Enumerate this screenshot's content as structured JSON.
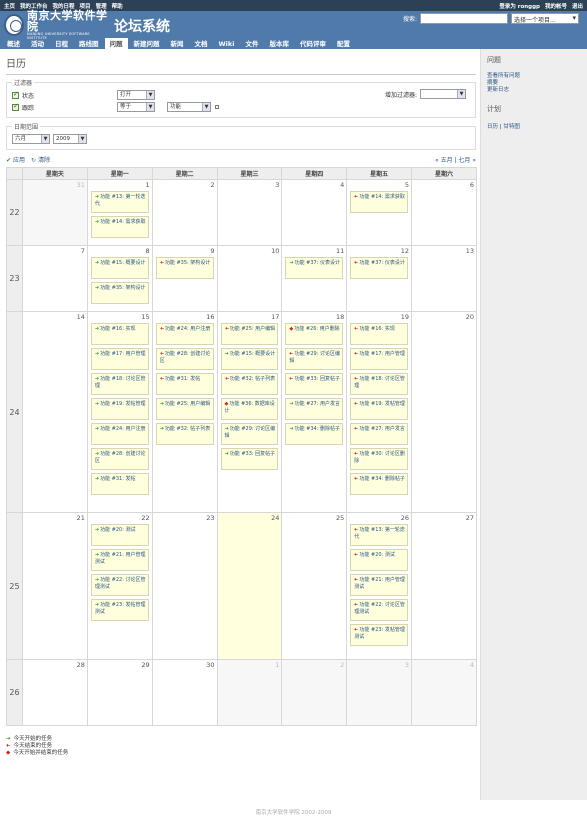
{
  "top_menu": {
    "left": [
      "主页",
      "我的工作台",
      "我的日程",
      "项目",
      "管理",
      "帮助"
    ],
    "right": [
      "登录为 ronggp",
      "我的帐号",
      "退出"
    ]
  },
  "header": {
    "logo_main": "南京大学软件学院",
    "logo_sub": "NANJING UNIVERSITY   SOFTWARE INSTITUTE",
    "project_title": "论坛系统",
    "search_label": "搜索:",
    "search_value": "",
    "project_jump": "选择一个项目..."
  },
  "main_menu": [
    {
      "label": "概述",
      "selected": false
    },
    {
      "label": "活动",
      "selected": false
    },
    {
      "label": "日程",
      "selected": false
    },
    {
      "label": "路线图",
      "selected": false
    },
    {
      "label": "问题",
      "selected": true
    },
    {
      "label": "新建问题",
      "selected": false
    },
    {
      "label": "新闻",
      "selected": false
    },
    {
      "label": "文档",
      "selected": false
    },
    {
      "label": "Wiki",
      "selected": false
    },
    {
      "label": "文件",
      "selected": false
    },
    {
      "label": "版本库",
      "selected": false
    },
    {
      "label": "代码评审",
      "selected": false
    },
    {
      "label": "配置",
      "selected": false
    }
  ],
  "page": {
    "title": "日历",
    "filters_legend": "过滤器",
    "filter_status": {
      "label": "状态",
      "operator": "打开"
    },
    "filter_tracker": {
      "label": "跟踪",
      "operator": "等于",
      "value": "功能"
    },
    "add_filter_label": "增加过滤器:",
    "date_range_legend": "日期范围",
    "month": "六月",
    "year": "2009",
    "apply": "应用",
    "clear": "清除",
    "month_nav": "« 五月 | 七月 »"
  },
  "calendar": {
    "weekdays": [
      "星期天",
      "星期一",
      "星期二",
      "星期三",
      "星期四",
      "星期五",
      "星期六"
    ],
    "weeks": [
      {
        "num": "22",
        "days": [
          {
            "d": "31",
            "odd": true,
            "issues": []
          },
          {
            "d": "1",
            "issues": [
              {
                "t": "start",
                "text": "功能 #13: 第一轮迭代"
              },
              {
                "t": "start",
                "text": "功能 #14: 需求获取"
              }
            ]
          },
          {
            "d": "2",
            "issues": []
          },
          {
            "d": "3",
            "issues": []
          },
          {
            "d": "4",
            "issues": []
          },
          {
            "d": "5",
            "issues": [
              {
                "t": "end",
                "text": "功能 #14: 需求获取"
              }
            ]
          },
          {
            "d": "6",
            "issues": []
          }
        ]
      },
      {
        "num": "23",
        "days": [
          {
            "d": "7",
            "issues": []
          },
          {
            "d": "8",
            "issues": [
              {
                "t": "start",
                "text": "功能 #15: 概要设计"
              },
              {
                "t": "start",
                "text": "功能 #35: 架构设计"
              }
            ]
          },
          {
            "d": "9",
            "issues": [
              {
                "t": "end",
                "text": "功能 #35: 架构设计"
              }
            ]
          },
          {
            "d": "10",
            "issues": []
          },
          {
            "d": "11",
            "issues": [
              {
                "t": "start",
                "text": "功能 #37: 仪表设计"
              }
            ]
          },
          {
            "d": "12",
            "issues": [
              {
                "t": "end",
                "text": "功能 #37: 仪表设计"
              }
            ]
          },
          {
            "d": "13",
            "issues": []
          }
        ]
      },
      {
        "num": "24",
        "days": [
          {
            "d": "14",
            "issues": []
          },
          {
            "d": "15",
            "issues": [
              {
                "t": "start",
                "text": "功能 #16: 实现"
              },
              {
                "t": "start",
                "text": "功能 #17: 用户管理"
              },
              {
                "t": "start",
                "text": "功能 #18: 讨论区管理"
              },
              {
                "t": "start",
                "text": "功能 #19: 发帖管理"
              },
              {
                "t": "start",
                "text": "功能 #24: 用户注册"
              },
              {
                "t": "start",
                "text": "功能 #28: 创建讨论区"
              },
              {
                "t": "start",
                "text": "功能 #31: 发帖"
              }
            ]
          },
          {
            "d": "16",
            "issues": [
              {
                "t": "end",
                "text": "功能 #24: 用户注册"
              },
              {
                "t": "end",
                "text": "功能 #28: 创建讨论区"
              },
              {
                "t": "end",
                "text": "功能 #31: 发帖"
              },
              {
                "t": "start",
                "text": "功能 #25: 用户编辑"
              },
              {
                "t": "start",
                "text": "功能 #32: 帖子列表"
              }
            ]
          },
          {
            "d": "17",
            "issues": [
              {
                "t": "end",
                "text": "功能 #25: 用户编辑"
              },
              {
                "t": "start",
                "text": "功能 #15: 概要设计"
              },
              {
                "t": "end",
                "text": "功能 #32: 帖子列表"
              },
              {
                "t": "both",
                "text": "功能 #36: 数据库设计"
              },
              {
                "t": "start",
                "text": "功能 #29: 讨论区编辑"
              },
              {
                "t": "start",
                "text": "功能 #33: 回复帖子"
              }
            ]
          },
          {
            "d": "18",
            "issues": [
              {
                "t": "both",
                "text": "功能 #26: 用户删除"
              },
              {
                "t": "end",
                "text": "功能 #29: 讨论区编辑"
              },
              {
                "t": "end",
                "text": "功能 #33: 回复帖子"
              },
              {
                "t": "start",
                "text": "功能 #27: 用户发言"
              },
              {
                "t": "start",
                "text": "功能 #34: 删除帖子"
              }
            ]
          },
          {
            "d": "19",
            "issues": [
              {
                "t": "end",
                "text": "功能 #16: 实现"
              },
              {
                "t": "end",
                "text": "功能 #17: 用户管理"
              },
              {
                "t": "end",
                "text": "功能 #18: 讨论区管理"
              },
              {
                "t": "end",
                "text": "功能 #19: 发帖管理"
              },
              {
                "t": "end",
                "text": "功能 #27: 用户发言"
              },
              {
                "t": "end",
                "text": "功能 #30: 讨论区删除"
              },
              {
                "t": "end",
                "text": "功能 #34: 删除帖子"
              }
            ]
          },
          {
            "d": "20",
            "issues": []
          }
        ]
      },
      {
        "num": "25",
        "days": [
          {
            "d": "21",
            "issues": []
          },
          {
            "d": "22",
            "issues": [
              {
                "t": "start",
                "text": "功能 #20: 测试"
              },
              {
                "t": "start",
                "text": "功能 #21: 用户管理测试"
              },
              {
                "t": "start",
                "text": "功能 #22: 讨论区管理测试"
              },
              {
                "t": "start",
                "text": "功能 #23: 发帖管理测试"
              }
            ]
          },
          {
            "d": "23",
            "issues": []
          },
          {
            "d": "24",
            "today": true,
            "issues": []
          },
          {
            "d": "25",
            "issues": []
          },
          {
            "d": "26",
            "issues": [
              {
                "t": "end",
                "text": "功能 #13: 第一轮迭代"
              },
              {
                "t": "end",
                "text": "功能 #20: 测试"
              },
              {
                "t": "end",
                "text": "功能 #21: 用户管理测试"
              },
              {
                "t": "end",
                "text": "功能 #22: 讨论区管理测试"
              },
              {
                "t": "end",
                "text": "功能 #23: 发帖管理测试"
              }
            ]
          },
          {
            "d": "27",
            "issues": []
          }
        ]
      },
      {
        "num": "26",
        "days": [
          {
            "d": "28",
            "issues": []
          },
          {
            "d": "29",
            "issues": []
          },
          {
            "d": "30",
            "issues": []
          },
          {
            "d": "1",
            "odd": true,
            "issues": []
          },
          {
            "d": "2",
            "odd": true,
            "issues": []
          },
          {
            "d": "3",
            "odd": true,
            "issues": []
          },
          {
            "d": "4",
            "odd": true,
            "issues": []
          }
        ]
      }
    ]
  },
  "legend": [
    {
      "t": "start",
      "text": "今天开始的任务"
    },
    {
      "t": "end",
      "text": "今天结束的任务"
    },
    {
      "t": "both",
      "text": "今天开始并结束的任务"
    }
  ],
  "sidebar": {
    "issues_title": "问题",
    "issues_links": [
      "查看所有问题",
      "摘要",
      "更新日志"
    ],
    "plan_title": "计划",
    "plan_links": [
      "日历",
      "甘特图"
    ]
  },
  "footer": "南京大学软件学院 2002-2009"
}
